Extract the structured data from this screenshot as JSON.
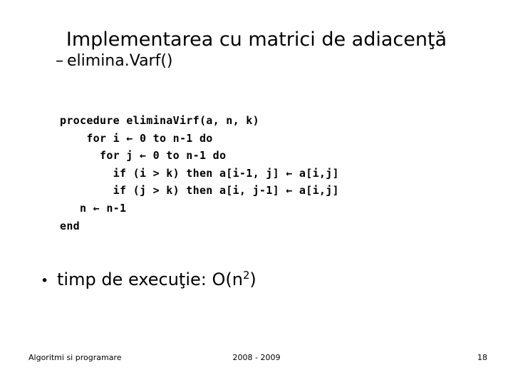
{
  "slide": {
    "title": "Implementarea cu matrici de adiacenţă",
    "background_color": "#ffffff",
    "text_color": "#000000"
  },
  "sub_bullet": {
    "marker": "–",
    "text": "elimina.Varf()"
  },
  "code": {
    "lines": [
      "procedure eliminaVirf(a, n, k)",
      "    for i ← 0 to n-1 do",
      "      for j ← 0 to n-1 do",
      "        if (i > k) then a[i-1, j] ← a[i,j]",
      "        if (j > k) then a[i, j-1] ← a[i,j]",
      "   n ← n-1",
      "end"
    ]
  },
  "main_bullet": {
    "marker": "•",
    "text_before": "timp de execuţie: O(n",
    "exponent": "2",
    "text_after": ")"
  },
  "footer": {
    "left": "Algoritmi si programare",
    "center": "2008 - 2009",
    "page_number": "18"
  }
}
